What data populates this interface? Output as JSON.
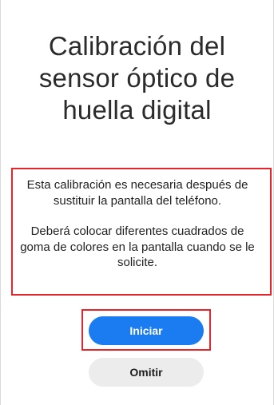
{
  "screen": {
    "title": "Calibración del sensor óptico de huella digital",
    "description": {
      "paragraph_1": "Esta calibración es necesaria después de sustituir la pantalla del teléfono.",
      "paragraph_2": "Deberá colocar diferentes cuadrados de goma de colores en la pantalla cuando se le solicite."
    },
    "buttons": {
      "start_label": "Iniciar",
      "skip_label": "Omitir"
    }
  },
  "colors": {
    "primary": "#1a7cf0",
    "secondary_button": "#ececec",
    "highlight_border": "#e3262b"
  }
}
